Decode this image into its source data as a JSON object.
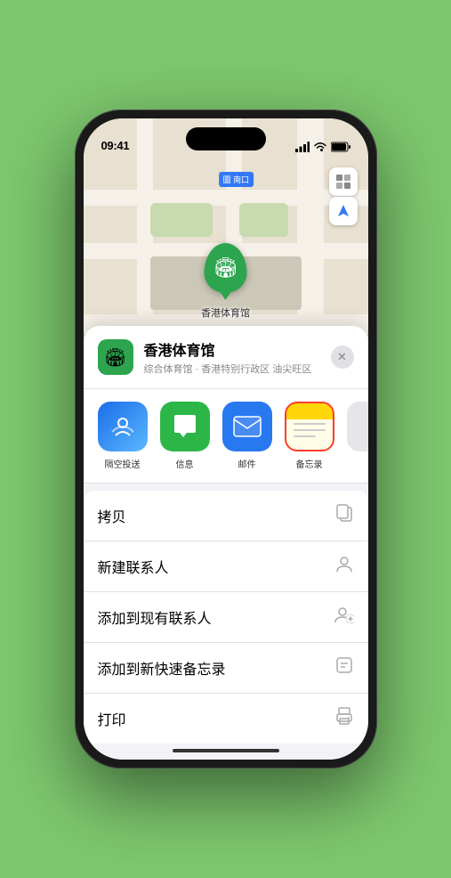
{
  "status_bar": {
    "time": "09:41",
    "time_icon": "▶",
    "signal": "●●●●",
    "wifi": "wifi",
    "battery": "battery"
  },
  "map": {
    "label": "南口",
    "label_prefix": "圖",
    "controls": {
      "map_icon": "🗺",
      "location_icon": "➤"
    }
  },
  "marker": {
    "label": "香港体育馆",
    "icon": "🏟"
  },
  "venue": {
    "name": "香港体育馆",
    "subtitle": "综合体育馆 · 香港特别行政区 油尖旺区",
    "close_label": "✕"
  },
  "share_items": [
    {
      "id": "airdrop",
      "label": "隔空投送",
      "icon": "📡"
    },
    {
      "id": "messages",
      "label": "信息",
      "icon": "💬"
    },
    {
      "id": "mail",
      "label": "邮件",
      "icon": "✉"
    },
    {
      "id": "notes",
      "label": "备忘录",
      "selected": true
    },
    {
      "id": "more",
      "label": "..."
    }
  ],
  "share_labels": {
    "airdrop": "隔空投送",
    "messages": "信息",
    "mail": "邮件",
    "notes": "备忘录"
  },
  "actions": [
    {
      "id": "copy",
      "label": "拷贝",
      "icon": "📋"
    },
    {
      "id": "new-contact",
      "label": "新建联系人",
      "icon": "👤"
    },
    {
      "id": "add-existing",
      "label": "添加到现有联系人",
      "icon": "👤"
    },
    {
      "id": "add-note",
      "label": "添加到新快速备忘录",
      "icon": "📝"
    },
    {
      "id": "print",
      "label": "打印",
      "icon": "🖨"
    }
  ]
}
